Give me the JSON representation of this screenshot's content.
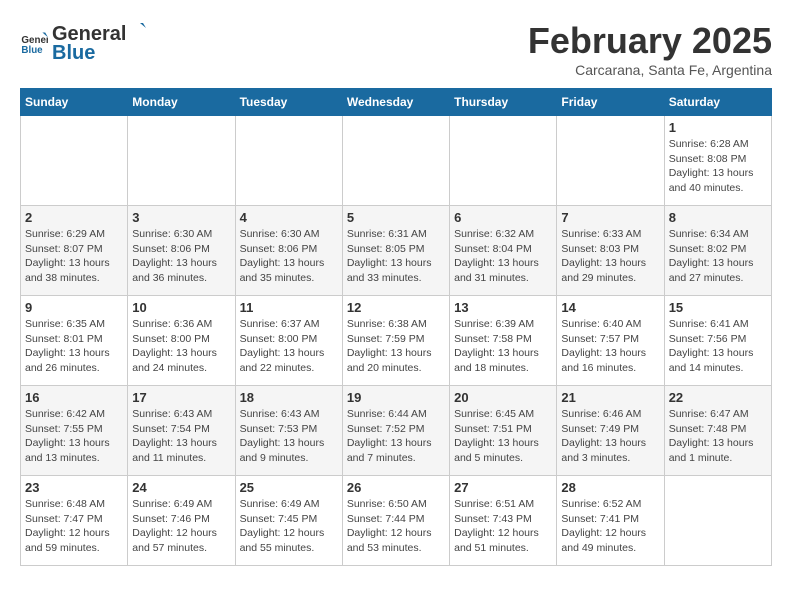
{
  "header": {
    "logo_general": "General",
    "logo_blue": "Blue",
    "title": "February 2025",
    "subtitle": "Carcarana, Santa Fe, Argentina"
  },
  "days_of_week": [
    "Sunday",
    "Monday",
    "Tuesday",
    "Wednesday",
    "Thursday",
    "Friday",
    "Saturday"
  ],
  "weeks": [
    [
      {
        "day": "",
        "info": ""
      },
      {
        "day": "",
        "info": ""
      },
      {
        "day": "",
        "info": ""
      },
      {
        "day": "",
        "info": ""
      },
      {
        "day": "",
        "info": ""
      },
      {
        "day": "",
        "info": ""
      },
      {
        "day": "1",
        "info": "Sunrise: 6:28 AM\nSunset: 8:08 PM\nDaylight: 13 hours and 40 minutes."
      }
    ],
    [
      {
        "day": "2",
        "info": "Sunrise: 6:29 AM\nSunset: 8:07 PM\nDaylight: 13 hours and 38 minutes."
      },
      {
        "day": "3",
        "info": "Sunrise: 6:30 AM\nSunset: 8:06 PM\nDaylight: 13 hours and 36 minutes."
      },
      {
        "day": "4",
        "info": "Sunrise: 6:30 AM\nSunset: 8:06 PM\nDaylight: 13 hours and 35 minutes."
      },
      {
        "day": "5",
        "info": "Sunrise: 6:31 AM\nSunset: 8:05 PM\nDaylight: 13 hours and 33 minutes."
      },
      {
        "day": "6",
        "info": "Sunrise: 6:32 AM\nSunset: 8:04 PM\nDaylight: 13 hours and 31 minutes."
      },
      {
        "day": "7",
        "info": "Sunrise: 6:33 AM\nSunset: 8:03 PM\nDaylight: 13 hours and 29 minutes."
      },
      {
        "day": "8",
        "info": "Sunrise: 6:34 AM\nSunset: 8:02 PM\nDaylight: 13 hours and 27 minutes."
      }
    ],
    [
      {
        "day": "9",
        "info": "Sunrise: 6:35 AM\nSunset: 8:01 PM\nDaylight: 13 hours and 26 minutes."
      },
      {
        "day": "10",
        "info": "Sunrise: 6:36 AM\nSunset: 8:00 PM\nDaylight: 13 hours and 24 minutes."
      },
      {
        "day": "11",
        "info": "Sunrise: 6:37 AM\nSunset: 8:00 PM\nDaylight: 13 hours and 22 minutes."
      },
      {
        "day": "12",
        "info": "Sunrise: 6:38 AM\nSunset: 7:59 PM\nDaylight: 13 hours and 20 minutes."
      },
      {
        "day": "13",
        "info": "Sunrise: 6:39 AM\nSunset: 7:58 PM\nDaylight: 13 hours and 18 minutes."
      },
      {
        "day": "14",
        "info": "Sunrise: 6:40 AM\nSunset: 7:57 PM\nDaylight: 13 hours and 16 minutes."
      },
      {
        "day": "15",
        "info": "Sunrise: 6:41 AM\nSunset: 7:56 PM\nDaylight: 13 hours and 14 minutes."
      }
    ],
    [
      {
        "day": "16",
        "info": "Sunrise: 6:42 AM\nSunset: 7:55 PM\nDaylight: 13 hours and 13 minutes."
      },
      {
        "day": "17",
        "info": "Sunrise: 6:43 AM\nSunset: 7:54 PM\nDaylight: 13 hours and 11 minutes."
      },
      {
        "day": "18",
        "info": "Sunrise: 6:43 AM\nSunset: 7:53 PM\nDaylight: 13 hours and 9 minutes."
      },
      {
        "day": "19",
        "info": "Sunrise: 6:44 AM\nSunset: 7:52 PM\nDaylight: 13 hours and 7 minutes."
      },
      {
        "day": "20",
        "info": "Sunrise: 6:45 AM\nSunset: 7:51 PM\nDaylight: 13 hours and 5 minutes."
      },
      {
        "day": "21",
        "info": "Sunrise: 6:46 AM\nSunset: 7:49 PM\nDaylight: 13 hours and 3 minutes."
      },
      {
        "day": "22",
        "info": "Sunrise: 6:47 AM\nSunset: 7:48 PM\nDaylight: 13 hours and 1 minute."
      }
    ],
    [
      {
        "day": "23",
        "info": "Sunrise: 6:48 AM\nSunset: 7:47 PM\nDaylight: 12 hours and 59 minutes."
      },
      {
        "day": "24",
        "info": "Sunrise: 6:49 AM\nSunset: 7:46 PM\nDaylight: 12 hours and 57 minutes."
      },
      {
        "day": "25",
        "info": "Sunrise: 6:49 AM\nSunset: 7:45 PM\nDaylight: 12 hours and 55 minutes."
      },
      {
        "day": "26",
        "info": "Sunrise: 6:50 AM\nSunset: 7:44 PM\nDaylight: 12 hours and 53 minutes."
      },
      {
        "day": "27",
        "info": "Sunrise: 6:51 AM\nSunset: 7:43 PM\nDaylight: 12 hours and 51 minutes."
      },
      {
        "day": "28",
        "info": "Sunrise: 6:52 AM\nSunset: 7:41 PM\nDaylight: 12 hours and 49 minutes."
      },
      {
        "day": "",
        "info": ""
      }
    ]
  ]
}
